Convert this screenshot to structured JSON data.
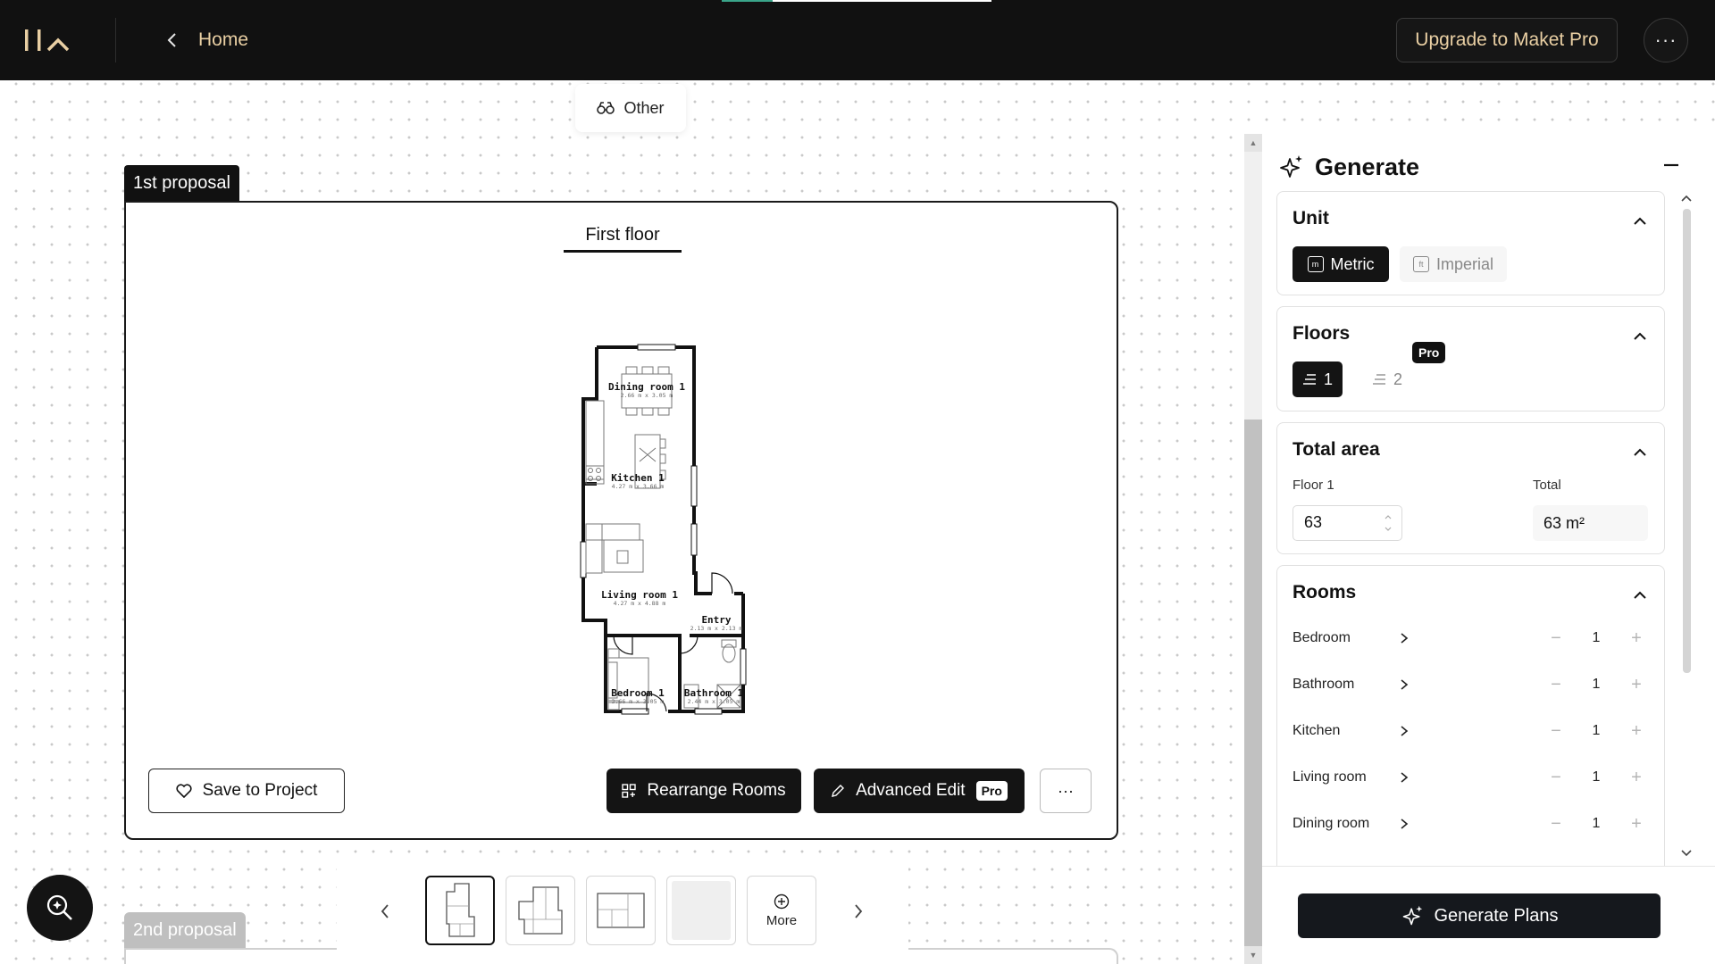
{
  "topbar": {
    "home_label": "Home",
    "upgrade_label": "Upgrade to Maket Pro",
    "progress_fraction": 0.19
  },
  "filter": {
    "label": "Other"
  },
  "proposals": {
    "first_tag": "1st proposal",
    "second_tag": "2nd proposal",
    "floor_tab": "First floor",
    "rooms": [
      {
        "label": "Dining room 1",
        "dims": "2.66 m x 3.05 m"
      },
      {
        "label": "Kitchen 1",
        "dims": "4.27 m x 3.66 m"
      },
      {
        "label": "Living room 1",
        "dims": "4.27 m x 4.88 m"
      },
      {
        "label": "Entry",
        "dims": "2.13 m x 2.13 m"
      },
      {
        "label": "Bedroom 1",
        "dims": "3.66 m x 3.05 m"
      },
      {
        "label": "Bathroom 1",
        "dims": "2.44 m x 3.05 m"
      }
    ]
  },
  "actions": {
    "save": "Save to Project",
    "rearrange": "Rearrange Rooms",
    "advanced_edit": "Advanced Edit",
    "pro_badge": "Pro",
    "more_dots": "···"
  },
  "thumbs": {
    "more_label": "More"
  },
  "panel": {
    "title": "Generate",
    "unit": {
      "title": "Unit",
      "metric": "Metric",
      "imperial": "Imperial",
      "metric_glyph": "m",
      "imperial_glyph": "ft"
    },
    "floors": {
      "title": "Floors",
      "option1": "1",
      "option2": "2",
      "pro": "Pro"
    },
    "area": {
      "title": "Total area",
      "floor_label": "Floor 1",
      "floor_value": "63",
      "total_label": "Total",
      "total_value": "63 m²"
    },
    "rooms": {
      "title": "Rooms",
      "items": [
        {
          "name": "Bedroom",
          "count": "1"
        },
        {
          "name": "Bathroom",
          "count": "1"
        },
        {
          "name": "Kitchen",
          "count": "1"
        },
        {
          "name": "Living room",
          "count": "1"
        },
        {
          "name": "Dining room",
          "count": "1"
        }
      ]
    },
    "generate_button": "Generate Plans"
  },
  "colors": {
    "topbar_bg": "#111111",
    "accent_gold": "#e9cfa3",
    "progress_green": "#3aa58a",
    "dark_button": "#141414"
  }
}
